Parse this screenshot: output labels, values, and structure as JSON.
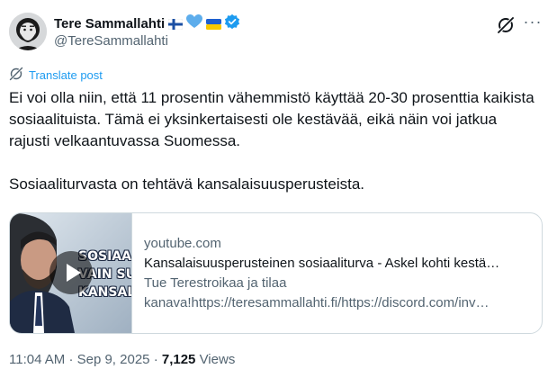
{
  "author": {
    "display_name": "Tere Sammallahti",
    "handle": "@TereSammallahti",
    "badges": [
      "finland-flag-icon",
      "blue-heart-icon",
      "ukraine-flag-icon",
      "verified-icon"
    ],
    "avatar_icon": "bearded-man-avatar"
  },
  "actions": {
    "grok_icon": "grok-icon",
    "more_icon": "more-icon",
    "more_glyph": "···"
  },
  "translate": {
    "icon": "translate-icon",
    "label": "Translate post"
  },
  "post": {
    "paragraph_1": "Ei voi olla niin, että 11 prosentin vähemmistö käyttää 20-30 prosenttia kaikista sosiaalituista. Tämä ei yksinkertaisesti ole kestävää, eikä näin voi jatkua rajusti velkaantuvassa Suomessa.",
    "paragraph_2": "Sosiaaliturvasta on tehtävä kansalaisuusperusteista."
  },
  "link_card": {
    "thumbnail_overlay": [
      "SOSIAALIT",
      "VAIN SUO",
      "KANSALAIS"
    ],
    "domain": "youtube.com",
    "title": "Kansalaisuusperusteinen sosiaaliturva - Askel kohti kestä…",
    "description": "Tue Terestroikaa ja tilaa kanava!https://teresammallahti.fi/https://discord.com/inv…"
  },
  "meta": {
    "time": "11:04 AM",
    "separator": "·",
    "date": "Sep 9, 2025",
    "views_count": "7,125",
    "views_label": "Views"
  },
  "colors": {
    "accent": "#1d9bf0",
    "text": "#0f1419",
    "secondary": "#536471",
    "border": "#cfd9de"
  }
}
